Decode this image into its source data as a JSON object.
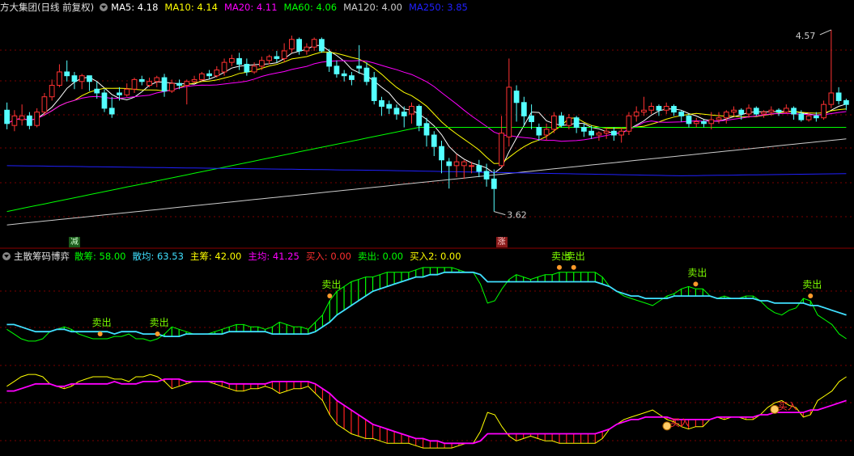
{
  "upper_panel": {
    "title": "方大集团(日线 前复权)",
    "ma_labels": [
      {
        "text": "MA5: 4.18",
        "color": "#ffffff"
      },
      {
        "text": "MA10: 4.14",
        "color": "#ffff00"
      },
      {
        "text": "MA20: 4.11",
        "color": "#ff00ff"
      },
      {
        "text": "MA60: 4.06",
        "color": "#00ff00"
      },
      {
        "text": "MA120: 4.00",
        "color": "#cccccc"
      },
      {
        "text": "MA250: 3.85",
        "color": "#2020ff"
      }
    ],
    "high_marker": "4.57",
    "low_marker": "3.62",
    "signal_reduce": "减",
    "signal_rise": "涨"
  },
  "lower_panel": {
    "title": "主散筹码博弈",
    "labels": [
      {
        "text": "散筹: 58.00",
        "color": "#00ff00"
      },
      {
        "text": "散均: 63.53",
        "color": "#40e0ff"
      },
      {
        "text": "主筹: 42.00",
        "color": "#ffff00"
      },
      {
        "text": "主均: 41.25",
        "color": "#ff00ff"
      },
      {
        "text": "买入: 0.00",
        "color": "#ff3030"
      },
      {
        "text": "卖出: 0.00",
        "color": "#00ff00"
      },
      {
        "text": "买入2: 0.00",
        "color": "#ffff00"
      }
    ],
    "sell_label": "卖出",
    "buy_label": "买入"
  },
  "chart_data": [
    {
      "type": "candlestick",
      "title": "方大集团(日线 前复权)",
      "ylim": [
        3.5,
        4.65
      ],
      "annotations": [
        {
          "text": "4.57",
          "value": 4.57
        },
        {
          "text": "3.62",
          "value": 3.62
        }
      ],
      "candles": [
        [
          4.15,
          4.08,
          4.19,
          4.05
        ],
        [
          4.07,
          4.12,
          4.15,
          4.04
        ],
        [
          4.1,
          4.12,
          4.18,
          4.07
        ],
        [
          4.12,
          4.07,
          4.14,
          4.05
        ],
        [
          4.07,
          4.14,
          4.16,
          4.06
        ],
        [
          4.14,
          4.22,
          4.24,
          4.12
        ],
        [
          4.22,
          4.28,
          4.31,
          4.2
        ],
        [
          4.28,
          4.35,
          4.39,
          4.27
        ],
        [
          4.35,
          4.33,
          4.41,
          4.3
        ],
        [
          4.33,
          4.3,
          4.35,
          4.26
        ],
        [
          4.3,
          4.33,
          4.34,
          4.26
        ],
        [
          4.33,
          4.3,
          4.33,
          4.25
        ],
        [
          4.26,
          4.24,
          4.3,
          4.21
        ],
        [
          4.24,
          4.16,
          4.26,
          4.14
        ],
        [
          4.16,
          4.13,
          4.22,
          4.11
        ],
        [
          4.24,
          4.23,
          4.27,
          4.2
        ],
        [
          4.23,
          4.26,
          4.29,
          4.22
        ],
        [
          4.26,
          4.31,
          4.32,
          4.24
        ],
        [
          4.31,
          4.3,
          4.33,
          4.28
        ],
        [
          4.28,
          4.3,
          4.32,
          4.27
        ],
        [
          4.3,
          4.32,
          4.33,
          4.27
        ],
        [
          4.32,
          4.25,
          4.34,
          4.22
        ],
        [
          4.25,
          4.29,
          4.31,
          4.24
        ],
        [
          4.29,
          4.28,
          4.31,
          4.26
        ],
        [
          4.28,
          4.3,
          4.31,
          4.18
        ],
        [
          4.3,
          4.31,
          4.33,
          4.29
        ],
        [
          4.31,
          4.34,
          4.35,
          4.3
        ],
        [
          4.34,
          4.33,
          4.36,
          4.31
        ],
        [
          4.33,
          4.36,
          4.38,
          4.32
        ],
        [
          4.35,
          4.4,
          4.42,
          4.33
        ],
        [
          4.4,
          4.42,
          4.44,
          4.38
        ],
        [
          4.42,
          4.39,
          4.45,
          4.36
        ],
        [
          4.39,
          4.35,
          4.42,
          4.33
        ],
        [
          4.35,
          4.38,
          4.4,
          4.34
        ],
        [
          4.38,
          4.41,
          4.43,
          4.36
        ],
        [
          4.41,
          4.43,
          4.44,
          4.39
        ],
        [
          4.43,
          4.42,
          4.46,
          4.4
        ],
        [
          4.42,
          4.46,
          4.5,
          4.4
        ],
        [
          4.47,
          4.52,
          4.54,
          4.45
        ],
        [
          4.52,
          4.46,
          4.53,
          4.44
        ],
        [
          4.46,
          4.48,
          4.5,
          4.44
        ],
        [
          4.48,
          4.52,
          4.53,
          4.46
        ],
        [
          4.52,
          4.46,
          4.53,
          4.45
        ],
        [
          4.45,
          4.38,
          4.47,
          4.35
        ],
        [
          4.38,
          4.34,
          4.41,
          4.32
        ],
        [
          4.34,
          4.33,
          4.36,
          4.3
        ],
        [
          4.33,
          4.31,
          4.35,
          4.28
        ],
        [
          4.38,
          4.37,
          4.49,
          4.34
        ],
        [
          4.37,
          4.3,
          4.4,
          4.28
        ],
        [
          4.32,
          4.2,
          4.35,
          4.18
        ],
        [
          4.2,
          4.17,
          4.22,
          4.12
        ],
        [
          4.18,
          4.16,
          4.2,
          4.13
        ],
        [
          4.16,
          4.13,
          4.18,
          4.1
        ],
        [
          4.14,
          4.12,
          4.17,
          4.06
        ],
        [
          4.13,
          4.17,
          4.19,
          4.08
        ],
        [
          4.17,
          4.07,
          4.18,
          4.04
        ],
        [
          4.08,
          4.02,
          4.11,
          3.96
        ],
        [
          4.02,
          3.96,
          4.04,
          3.91
        ],
        [
          3.96,
          3.89,
          3.99,
          3.82
        ],
        [
          3.88,
          3.86,
          3.9,
          3.74
        ],
        [
          3.86,
          3.88,
          3.92,
          3.8
        ],
        [
          3.86,
          3.88,
          3.89,
          3.79
        ],
        [
          3.86,
          3.86,
          3.88,
          3.82
        ],
        [
          3.86,
          3.83,
          3.89,
          3.8
        ],
        [
          3.83,
          3.79,
          3.87,
          3.75
        ],
        [
          3.79,
          3.74,
          3.84,
          3.62
        ],
        [
          3.86,
          4.03,
          4.12,
          3.85
        ],
        [
          4.01,
          4.27,
          4.42,
          3.96
        ],
        [
          4.25,
          4.19,
          4.28,
          4.09
        ],
        [
          4.19,
          4.12,
          4.22,
          4.07
        ],
        [
          4.12,
          4.09,
          4.18,
          4.05
        ],
        [
          4.06,
          4.02,
          4.08,
          3.99
        ],
        [
          4.02,
          4.05,
          4.08,
          3.99
        ],
        [
          4.05,
          4.12,
          4.14,
          4.03
        ],
        [
          4.12,
          4.07,
          4.14,
          4.06
        ],
        [
          4.07,
          4.11,
          4.13,
          4.05
        ],
        [
          4.11,
          4.06,
          4.12,
          4.03
        ],
        [
          4.06,
          4.04,
          4.08,
          4.01
        ],
        [
          4.04,
          4.02,
          4.07,
          4.0
        ],
        [
          4.02,
          4.03,
          4.04,
          3.99
        ],
        [
          4.03,
          4.04,
          4.06,
          4.0
        ],
        [
          4.04,
          4.02,
          4.06,
          3.99
        ],
        [
          4.02,
          4.04,
          4.06,
          3.98
        ],
        [
          4.04,
          4.12,
          4.14,
          4.02
        ],
        [
          4.12,
          4.14,
          4.17,
          4.09
        ],
        [
          4.14,
          4.15,
          4.22,
          4.12
        ],
        [
          4.15,
          4.17,
          4.19,
          4.13
        ],
        [
          4.17,
          4.15,
          4.18,
          4.12
        ],
        [
          4.15,
          4.17,
          4.19,
          4.13
        ],
        [
          4.17,
          4.14,
          4.18,
          4.12
        ],
        [
          4.14,
          4.12,
          4.15,
          4.09
        ],
        [
          4.12,
          4.08,
          4.13,
          4.06
        ],
        [
          4.08,
          4.09,
          4.11,
          4.06
        ],
        [
          4.09,
          4.08,
          4.1,
          4.06
        ],
        [
          4.08,
          4.1,
          4.14,
          4.05
        ],
        [
          4.1,
          4.11,
          4.14,
          4.08
        ],
        [
          4.11,
          4.14,
          4.15,
          4.08
        ],
        [
          4.14,
          4.15,
          4.17,
          4.12
        ],
        [
          4.15,
          4.13,
          4.16,
          4.1
        ],
        [
          4.13,
          4.16,
          4.18,
          4.11
        ],
        [
          4.16,
          4.13,
          4.17,
          4.12
        ],
        [
          4.13,
          4.14,
          4.15,
          4.11
        ],
        [
          4.14,
          4.15,
          4.17,
          4.12
        ],
        [
          4.15,
          4.14,
          4.16,
          4.12
        ],
        [
          4.14,
          4.16,
          4.18,
          4.13
        ],
        [
          4.16,
          4.13,
          4.17,
          4.1
        ],
        [
          4.13,
          4.1,
          4.15,
          4.09
        ],
        [
          4.1,
          4.12,
          4.14,
          4.09
        ],
        [
          4.12,
          4.11,
          4.14,
          4.09
        ],
        [
          4.11,
          4.18,
          4.2,
          4.1
        ],
        [
          4.18,
          4.24,
          4.57,
          4.16
        ],
        [
          4.24,
          4.2,
          4.27,
          4.18
        ],
        [
          4.2,
          4.18,
          4.21,
          4.15
        ]
      ],
      "series": [
        {
          "name": "MA5",
          "color": "#ffffff"
        },
        {
          "name": "MA10",
          "color": "#ffff00"
        },
        {
          "name": "MA20",
          "color": "#ff00ff"
        },
        {
          "name": "MA60",
          "color": "#00ff00"
        },
        {
          "name": "MA120",
          "color": "#cccccc"
        },
        {
          "name": "MA250",
          "color": "#2020ff"
        }
      ],
      "signals": [
        {
          "index": 9,
          "text": "减"
        },
        {
          "index": 66,
          "text": "涨"
        }
      ]
    },
    {
      "type": "line",
      "title": "主散筹码博弈",
      "series": [
        {
          "name": "散筹",
          "color": "#00ff00",
          "values": [
            62,
            60,
            58,
            57,
            57,
            58,
            61,
            62,
            63,
            62,
            60,
            59,
            58,
            58,
            58,
            59,
            59,
            60,
            58,
            58,
            57,
            58,
            60,
            63,
            62,
            61,
            60,
            60,
            60,
            61,
            62,
            63,
            64,
            64,
            63,
            63,
            62,
            63,
            65,
            64,
            63,
            63,
            62,
            65,
            68,
            74,
            78,
            80,
            82,
            83,
            84,
            84,
            85,
            86,
            86,
            86,
            86,
            87,
            88,
            88,
            88,
            88,
            88,
            87,
            86,
            86,
            81,
            73,
            74,
            79,
            83,
            85,
            84,
            83,
            84,
            85,
            85,
            86,
            86,
            86,
            86,
            86,
            86,
            84,
            80,
            78,
            76,
            75,
            74,
            73,
            72,
            74,
            76,
            77,
            79,
            80,
            79,
            79,
            76,
            75,
            76,
            75,
            75,
            76,
            76,
            74,
            71,
            69,
            68,
            70,
            71,
            75,
            74,
            68,
            66,
            64,
            60,
            58
          ]
        },
        {
          "name": "散均",
          "color": "#40e0ff",
          "values": [
            64,
            64,
            63,
            62,
            61,
            61,
            61,
            62,
            62,
            61,
            61,
            61,
            61,
            61,
            61,
            60,
            61,
            61,
            61,
            60,
            60,
            60,
            59,
            59,
            59,
            60,
            60,
            60,
            60,
            60,
            60,
            61,
            61,
            61,
            61,
            61,
            61,
            60,
            60,
            60,
            60,
            60,
            60,
            61,
            63,
            65,
            68,
            70,
            72,
            74,
            76,
            78,
            79,
            80,
            81,
            82,
            83,
            84,
            84,
            85,
            85,
            86,
            86,
            86,
            86,
            86,
            85,
            82,
            82,
            82,
            82,
            82,
            82,
            82,
            82,
            82,
            82,
            82,
            82,
            82,
            82,
            82,
            82,
            81,
            80,
            78,
            77,
            76,
            76,
            75,
            75,
            75,
            75,
            76,
            76,
            76,
            76,
            76,
            76,
            75,
            75,
            75,
            75,
            75,
            75,
            74,
            74,
            73,
            73,
            73,
            73,
            73,
            72,
            72,
            71,
            70,
            69,
            68
          ]
        },
        {
          "name": "主筹",
          "color": "#ffff00",
          "values": [
            38,
            40,
            42,
            43,
            43,
            42,
            39,
            38,
            37,
            38,
            40,
            41,
            42,
            42,
            42,
            41,
            41,
            40,
            42,
            42,
            43,
            42,
            40,
            37,
            38,
            39,
            40,
            40,
            40,
            39,
            38,
            37,
            36,
            36,
            37,
            37,
            38,
            37,
            35,
            36,
            37,
            37,
            38,
            35,
            32,
            26,
            22,
            20,
            18,
            17,
            16,
            16,
            15,
            14,
            14,
            14,
            14,
            13,
            12,
            12,
            12,
            12,
            12,
            13,
            14,
            14,
            19,
            27,
            26,
            21,
            17,
            15,
            16,
            17,
            16,
            15,
            15,
            14,
            14,
            14,
            14,
            14,
            14,
            16,
            20,
            22,
            24,
            25,
            26,
            27,
            28,
            26,
            24,
            23,
            21,
            20,
            21,
            21,
            24,
            25,
            24,
            25,
            25,
            24,
            24,
            26,
            29,
            31,
            32,
            30,
            29,
            25,
            26,
            32,
            34,
            36,
            40,
            42
          ]
        },
        {
          "name": "主均",
          "color": "#ff00ff",
          "values": [
            36,
            36,
            37,
            38,
            39,
            39,
            39,
            38,
            38,
            39,
            39,
            39,
            39,
            39,
            39,
            40,
            39,
            39,
            39,
            40,
            40,
            40,
            41,
            41,
            41,
            40,
            40,
            40,
            40,
            40,
            40,
            39,
            39,
            39,
            39,
            39,
            39,
            40,
            40,
            40,
            40,
            40,
            40,
            39,
            37,
            35,
            32,
            30,
            28,
            26,
            24,
            22,
            21,
            20,
            19,
            18,
            17,
            16,
            16,
            15,
            15,
            14,
            14,
            14,
            14,
            14,
            15,
            18,
            18,
            18,
            18,
            18,
            18,
            18,
            18,
            18,
            18,
            18,
            18,
            18,
            18,
            18,
            18,
            19,
            20,
            22,
            23,
            24,
            24,
            25,
            25,
            25,
            25,
            24,
            24,
            24,
            24,
            24,
            24,
            25,
            25,
            25,
            25,
            25,
            25,
            26,
            26,
            27,
            27,
            27,
            27,
            27,
            28,
            28,
            29,
            30,
            31,
            32
          ]
        }
      ],
      "sell_signals": [
        16,
        26,
        56,
        97,
        99,
        121,
        140
      ],
      "buy_signals": [
        116,
        134
      ]
    }
  ]
}
